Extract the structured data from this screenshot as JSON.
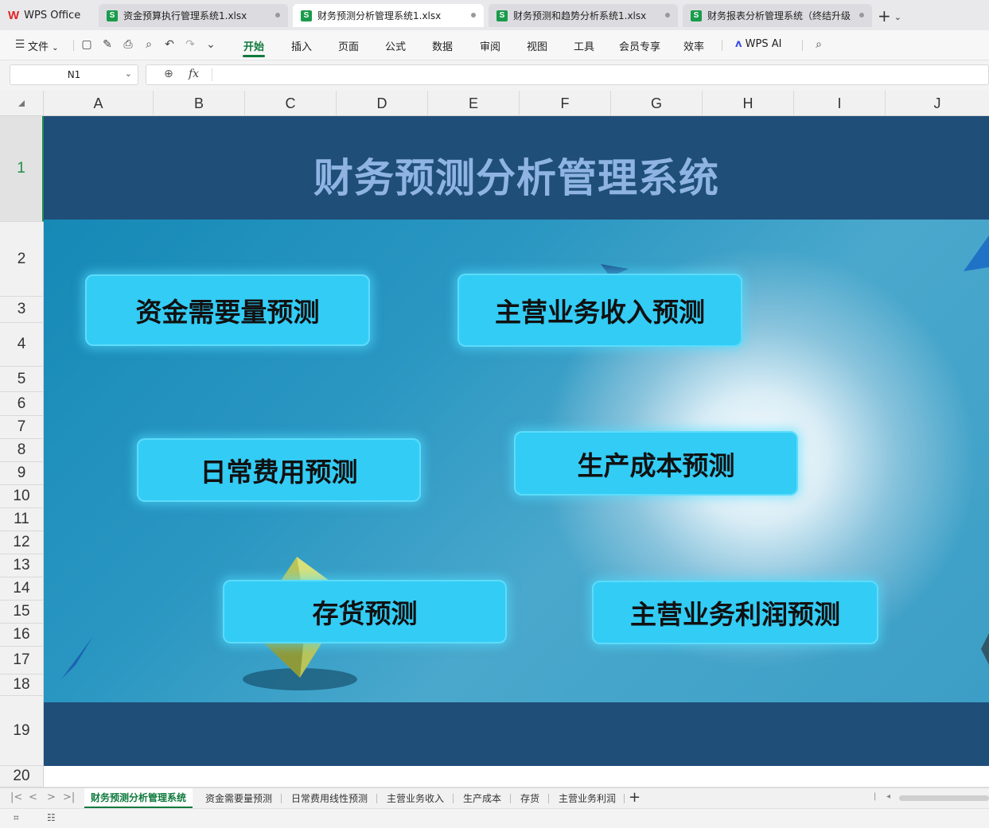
{
  "app": {
    "logo_label": "WPS Office",
    "tabs": [
      {
        "label": "资金预算执行管理系统1.xlsx",
        "badge": "S"
      },
      {
        "label": "财务预测分析管理系统1.xlsx",
        "badge": "S"
      },
      {
        "label": "财务预测和趋势分析系统1.xlsx",
        "badge": "S"
      },
      {
        "label": "财务报表分析管理系统（终结升级",
        "badge": "S"
      }
    ],
    "new_tab_label": "+"
  },
  "ribbon": {
    "file_menu": "文件",
    "items": [
      "开始",
      "插入",
      "页面",
      "公式",
      "数据",
      "审阅",
      "视图",
      "工具",
      "会员专享",
      "效率"
    ],
    "ai_label": "WPS AI"
  },
  "formula_bar": {
    "cell_ref": "N1",
    "fx_label": "fx",
    "content": ""
  },
  "columns": [
    "A",
    "B",
    "C",
    "D",
    "E",
    "F",
    "G",
    "H",
    "I",
    "J"
  ],
  "rows": [
    "1",
    "2",
    "3",
    "4",
    "5",
    "6",
    "7",
    "8",
    "9",
    "10",
    "11",
    "12",
    "13",
    "14",
    "15",
    "16",
    "17",
    "18",
    "19",
    "20"
  ],
  "sheet": {
    "title": "财务预测分析管理系统",
    "title_color": "#8fb4e3",
    "band_color": "#1f4e79",
    "button_color": "#33ccf5",
    "buttons": [
      {
        "label": "资金需要量预测"
      },
      {
        "label": "主营业务收入预测"
      },
      {
        "label": "日常费用预测"
      },
      {
        "label": "生产成本预测"
      },
      {
        "label": "存货预测"
      },
      {
        "label": "主营业务利润预测"
      }
    ]
  },
  "sheet_tabs": [
    "财务预测分析管理系统",
    "资金需要量预测",
    "日常费用线性预测",
    "主营业务收入",
    "生产成本",
    "存货",
    "主营业务利润"
  ],
  "add_sheet_label": "+"
}
